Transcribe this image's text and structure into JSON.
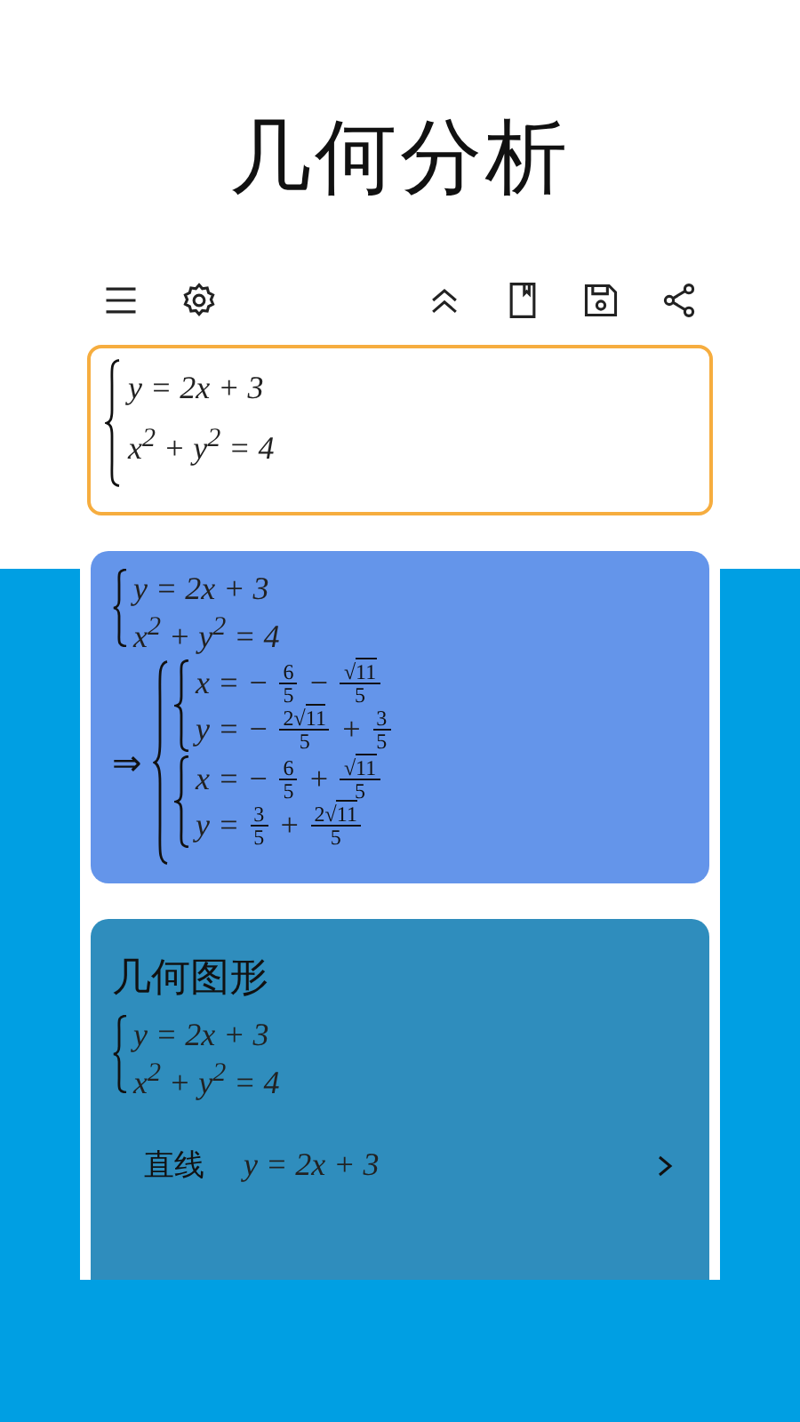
{
  "title": "几何分析",
  "input": {
    "equations": [
      "y = 2x + 3",
      "x$^{2}$ + y$^{2}$ = 4"
    ]
  },
  "result": {
    "system": [
      "y = 2x + 3",
      "x$^{2}$ + y$^{2}$ = 4"
    ],
    "arrow": "⇒",
    "solutions": [
      [
        [
          {
            "kind": "text",
            "text": "x = −"
          },
          {
            "kind": "frac",
            "num": "6",
            "den": "5"
          },
          {
            "kind": "text",
            "text": "−"
          },
          {
            "kind": "frac",
            "root": "√",
            "radicand": "11",
            "den": "5"
          }
        ],
        [
          {
            "kind": "text",
            "text": "y = −"
          },
          {
            "kind": "frac",
            "coef": "2",
            "root": "√",
            "radicand": "11",
            "den": "5"
          },
          {
            "kind": "text",
            "text": "+"
          },
          {
            "kind": "frac",
            "num": "3",
            "den": "5"
          }
        ]
      ],
      [
        [
          {
            "kind": "text",
            "text": "x = −"
          },
          {
            "kind": "frac",
            "num": "6",
            "den": "5"
          },
          {
            "kind": "text",
            "text": "+"
          },
          {
            "kind": "frac",
            "root": "√",
            "radicand": "11",
            "den": "5"
          }
        ],
        [
          {
            "kind": "text",
            "text": "y ="
          },
          {
            "kind": "frac",
            "num": "3",
            "den": "5"
          },
          {
            "kind": "text",
            "text": "+"
          },
          {
            "kind": "frac",
            "coef": "2",
            "root": "√",
            "radicand": "11",
            "den": "5"
          }
        ]
      ]
    ]
  },
  "geometry": {
    "heading": "几何图形",
    "system": [
      "y = 2x + 3",
      "x$^{2}$ + y$^{2}$ = 4"
    ],
    "items": [
      {
        "label": "直线",
        "equation": "y = 2x + 3"
      }
    ]
  }
}
